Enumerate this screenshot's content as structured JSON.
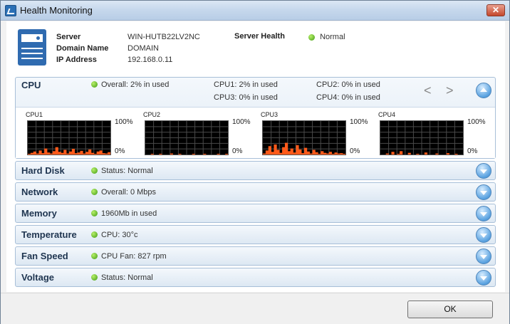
{
  "window": {
    "title": "Health Monitoring"
  },
  "server": {
    "server_label": "Server",
    "server_value": "WIN-HUTB22LV2NC",
    "domain_label": "Domain Name",
    "domain_value": "DOMAIN",
    "ip_label": "IP Address",
    "ip_value": "192.168.0.11",
    "health_label": "Server Health",
    "health_value": "Normal"
  },
  "cpu": {
    "title": "CPU",
    "overall": "Overall: 2% in used",
    "cpu1": "CPU1: 2% in used",
    "cpu2": "CPU2: 0% in used",
    "cpu3": "CPU3: 0% in used",
    "cpu4": "CPU4: 0% in used",
    "prev_icon": "<",
    "next_icon": ">",
    "graphs": [
      {
        "label": "CPU1",
        "max": "100%",
        "min": "0%",
        "usage": [
          2,
          5,
          9,
          3,
          12,
          4,
          18,
          6,
          3,
          10,
          22,
          8,
          5,
          14,
          3,
          9,
          17,
          4,
          6,
          11,
          3,
          8,
          15,
          5,
          2,
          9,
          12,
          4,
          3,
          7
        ]
      },
      {
        "label": "CPU2",
        "max": "100%",
        "min": "0%",
        "usage": [
          0,
          0,
          2,
          0,
          0,
          1,
          0,
          0,
          0,
          3,
          0,
          0,
          1,
          0,
          0,
          0,
          0,
          2,
          0,
          0,
          0,
          1,
          0,
          0,
          0,
          0,
          1,
          0,
          0,
          2
        ]
      },
      {
        "label": "CPU3",
        "max": "100%",
        "min": "0%",
        "usage": [
          3,
          12,
          25,
          8,
          30,
          14,
          5,
          22,
          35,
          10,
          18,
          6,
          28,
          15,
          4,
          20,
          9,
          3,
          14,
          7,
          2,
          10,
          5,
          3,
          8,
          2,
          6,
          3,
          4,
          2
        ]
      },
      {
        "label": "CPU4",
        "max": "100%",
        "min": "0%",
        "usage": [
          0,
          0,
          3,
          0,
          8,
          0,
          2,
          10,
          0,
          0,
          5,
          0,
          0,
          2,
          0,
          0,
          6,
          0,
          0,
          0,
          3,
          0,
          0,
          0,
          4,
          0,
          0,
          2,
          0,
          0
        ]
      }
    ]
  },
  "panels": [
    {
      "title": "Hard Disk",
      "status": "Status: Normal"
    },
    {
      "title": "Network",
      "status": "Overall: 0 Mbps"
    },
    {
      "title": "Memory",
      "status": "1960Mb in used"
    },
    {
      "title": "Temperature",
      "status": "CPU: 30°c"
    },
    {
      "title": "Fan Speed",
      "status": "CPU Fan: 827 rpm"
    },
    {
      "title": "Voltage",
      "status": "Status: Normal"
    }
  ],
  "footer": {
    "ok_label": "OK"
  },
  "colors": {
    "graph_fill": "#ff5a1a",
    "graph_bg": "#000000",
    "grid": "#4a4a4a",
    "status_ok": "#4caf1a",
    "accent": "#2f6bb0"
  },
  "icons": {
    "app": "health-monitor-icon",
    "server": "server-icon",
    "expand": "chevron-down-icon",
    "collapse": "chevron-up-icon"
  }
}
